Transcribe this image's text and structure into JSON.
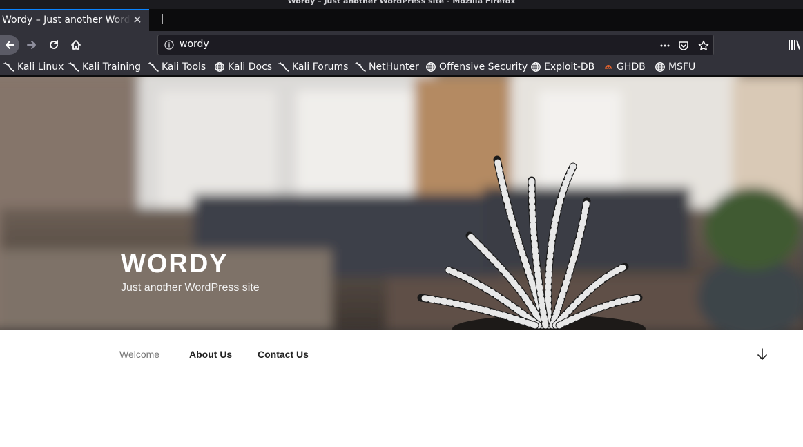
{
  "browser": {
    "window_title": "Wordy – Just another WordPress site - Mozilla Firefox",
    "tab": {
      "title": "Wordy – Just another WordPress site",
      "close_glyph": "✕"
    },
    "new_tab_glyph": "+",
    "url": "wordy",
    "accent_color": "#0a84ff",
    "bookmarks": [
      {
        "label": "Kali Linux",
        "icon": "kali-dragon-icon"
      },
      {
        "label": "Kali Training",
        "icon": "kali-dragon-icon"
      },
      {
        "label": "Kali Tools",
        "icon": "kali-dragon-icon"
      },
      {
        "label": "Kali Docs",
        "icon": "globe-icon"
      },
      {
        "label": "Kali Forums",
        "icon": "kali-dragon-icon"
      },
      {
        "label": "NetHunter",
        "icon": "kali-dragon-icon"
      },
      {
        "label": "Offensive Security",
        "icon": "globe-icon"
      },
      {
        "label": "Exploit-DB",
        "icon": "globe-icon"
      },
      {
        "label": "GHDB",
        "icon": "ghdb-icon"
      },
      {
        "label": "MSFU",
        "icon": "globe-icon"
      }
    ]
  },
  "site": {
    "title": "WORDY",
    "description": "Just another WordPress site",
    "menu": [
      {
        "label": "Welcome",
        "current": true
      },
      {
        "label": "About Us",
        "current": false
      },
      {
        "label": "Contact Us",
        "current": false
      }
    ]
  }
}
